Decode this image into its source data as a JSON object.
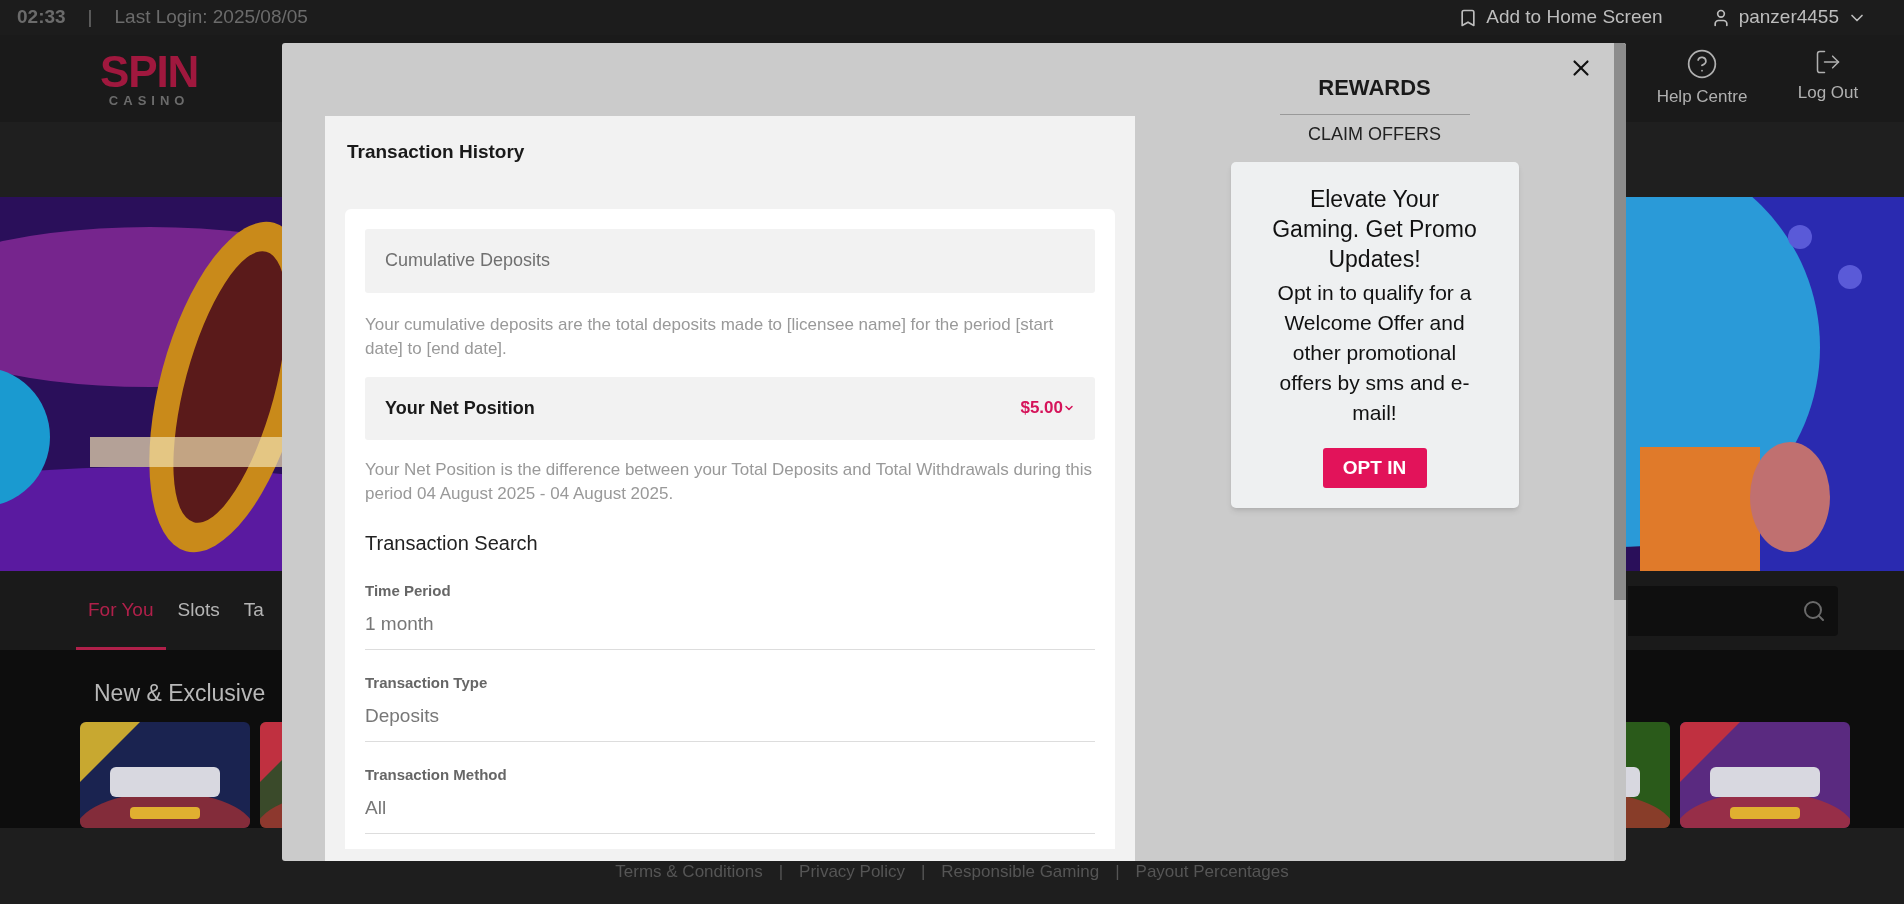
{
  "top_bar": {
    "time": "02:33",
    "separator": "|",
    "last_login": "Last Login: 2025/08/05",
    "add_to_home": "Add to Home Screen",
    "username": "panzer4455"
  },
  "header": {
    "logo": {
      "word": "SPIN",
      "sub": "CASINO"
    },
    "actions": [
      {
        "kind": "help",
        "label": "Help Centre"
      },
      {
        "kind": "logout",
        "label": "Log Out"
      }
    ]
  },
  "tabs": [
    {
      "label": "For You",
      "selected": true
    },
    {
      "label": "Slots",
      "selected": false
    },
    {
      "label": "Ta",
      "selected": false
    }
  ],
  "section": {
    "title": "New & Exclusive"
  },
  "footer": {
    "links": [
      "Terms & Conditions",
      "Privacy Policy",
      "Responsible Gaming",
      "Payout Percentages"
    ],
    "separator": "|"
  },
  "modal": {
    "transaction_history": {
      "title": "Transaction History",
      "cumulative": {
        "label": "Cumulative Deposits",
        "note": "Your cumulative deposits are the total deposits made to [licensee name] for the period [start date] to [end date]."
      },
      "net_position": {
        "label": "Your Net Position",
        "value": "$5.00",
        "expanded": false,
        "note": "Your Net Position is the difference between your Total Deposits and Total Withdrawals during this period 04 August 2025 - 04 August 2025."
      },
      "search_title": "Transaction Search",
      "fields": [
        {
          "label": "Time Period",
          "value": "1 month"
        },
        {
          "label": "Transaction Type",
          "value": "Deposits"
        },
        {
          "label": "Transaction Method",
          "value": "All"
        }
      ]
    },
    "rewards": {
      "title": "REWARDS",
      "subtitle": "CLAIM OFFERS",
      "promo": {
        "heading": "Elevate Your Gaming. Get Promo Updates!",
        "body": "Opt in to qualify for a Welcome Offer and other promotional offers by sms and e-mail!",
        "button": "OPT IN"
      }
    }
  }
}
